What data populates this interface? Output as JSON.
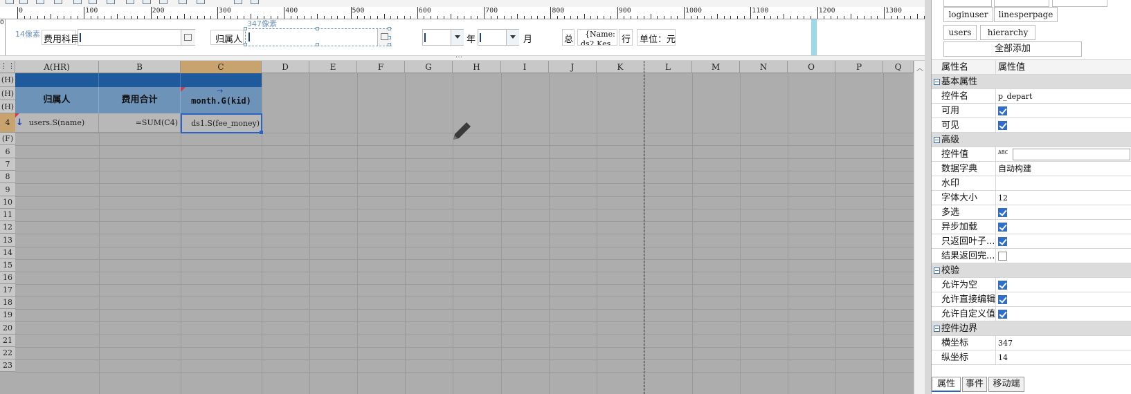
{
  "ruler": {
    "labels": [
      "0",
      "100",
      "200",
      "300",
      "400",
      "500",
      "600",
      "700",
      "800",
      "900",
      "1000",
      "1100",
      "1200",
      "1300"
    ],
    "v_label": "0"
  },
  "form": {
    "margin_hint": "14像素",
    "pos_hint": "347像素",
    "field1_label": "费用科目",
    "field2_label": "归属人",
    "year_label": "年",
    "month_label": "月",
    "total_label": "总",
    "total_value": "{Name:",
    "total_value2": "ds2.Kes",
    "row_label": "行",
    "unit_label": "单位：元"
  },
  "grid": {
    "columns": [
      "A(HR)",
      "B",
      "C",
      "D",
      "E",
      "F",
      "G",
      "H",
      "I",
      "J",
      "K",
      "L",
      "M",
      "N",
      "O",
      "P",
      "Q"
    ],
    "rows": [
      "(H)",
      "(H)",
      "(H)",
      "4",
      "(F)",
      "6",
      "7",
      "8",
      "9",
      "10",
      "11",
      "12",
      "13",
      "14",
      "15",
      "16",
      "17",
      "18",
      "19",
      "20",
      "21",
      "22",
      "23"
    ],
    "header_cells": {
      "a": "归属人",
      "b": "费用合计",
      "c": "month.G(kid)"
    },
    "data_cells": {
      "a": "users.S(name)",
      "b": "=SUM(C4)",
      "c": "ds1.S(fee_money)"
    },
    "drag_handle": "…",
    "corner_icon": "grid-menu-icon"
  },
  "panel": {
    "top_tags": [
      "loginuser",
      "linesperpage",
      "users",
      "hierarchy"
    ],
    "add_all": "全部添加",
    "header_name": "属性名",
    "header_value": "属性值",
    "rows": [
      {
        "type": "cat",
        "name": "基本属性"
      },
      {
        "type": "text",
        "name": "控件名",
        "value": "p_depart"
      },
      {
        "type": "check",
        "name": "可用",
        "checked": true
      },
      {
        "type": "check",
        "name": "可见",
        "checked": true
      },
      {
        "type": "cat",
        "name": "高级"
      },
      {
        "type": "input",
        "name": "控件值",
        "value": ""
      },
      {
        "type": "text",
        "name": "数据字典",
        "value": "自动构建"
      },
      {
        "type": "text",
        "name": "水印",
        "value": ""
      },
      {
        "type": "text",
        "name": "字体大小",
        "value": "12"
      },
      {
        "type": "check",
        "name": "多选",
        "checked": true
      },
      {
        "type": "check",
        "name": "异步加载",
        "checked": true
      },
      {
        "type": "check",
        "name": "只返回叶子...",
        "checked": true
      },
      {
        "type": "check",
        "name": "结果返回完...",
        "checked": false
      },
      {
        "type": "cat",
        "name": "校验"
      },
      {
        "type": "check",
        "name": "允许为空",
        "checked": true
      },
      {
        "type": "check",
        "name": "允许直接编辑",
        "checked": true
      },
      {
        "type": "check",
        "name": "允许自定义值",
        "checked": true
      },
      {
        "type": "cat",
        "name": "控件边界"
      },
      {
        "type": "text",
        "name": "横坐标",
        "value": "347"
      },
      {
        "type": "text",
        "name": "纵坐标",
        "value": "14"
      }
    ],
    "tabs": [
      "属性",
      "事件",
      "移动端"
    ]
  },
  "colors": {
    "header_blue": "#1e5a9c",
    "header_light": "#6d93b8",
    "selected_col": "#c9a36e",
    "grid_bg": "#adadad",
    "selection": "#2b63c4"
  }
}
